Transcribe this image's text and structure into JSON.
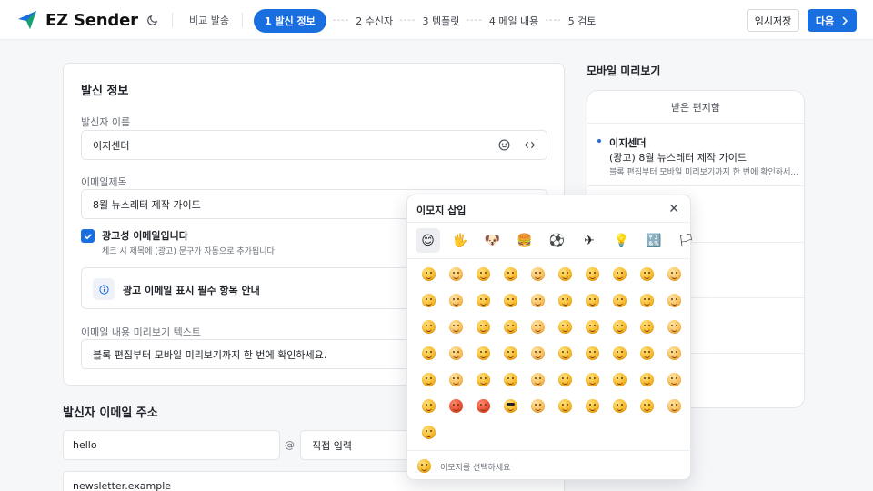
{
  "app": {
    "name": "EZ Sender",
    "accent": "#1a6fe0"
  },
  "header": {
    "nav_link": "비교 발송",
    "steps": [
      {
        "label": "1  발신 정보",
        "active": true
      },
      {
        "label": "2  수신자"
      },
      {
        "label": "3  템플릿"
      },
      {
        "label": "4  메일 내용"
      },
      {
        "label": "5  검토"
      }
    ],
    "step_separator": "----",
    "draft_button": "임시저장",
    "next_button": "다음"
  },
  "form": {
    "title": "발신 정보",
    "sender_name": {
      "label": "발신자 이름",
      "value": "이지센더"
    },
    "subject": {
      "label": "이메일제목",
      "value": "8월 뉴스레터 제작 가이드"
    },
    "ad_check": {
      "label": "광고성 이메일입니다",
      "hint": "체크 시 제목에 (광고) 문구가 자동으로 추가됩니다",
      "checked": true
    },
    "notice": "광고 이메일 표시 필수 항목 안내",
    "preheader": {
      "label": "이메일 내용 미리보기 텍스트",
      "value": "블록 편집부터 모바일 미리보기까지 한 번에 확인하세요."
    }
  },
  "sender_email": {
    "title": "발신자 이메일 주소",
    "local_part": "hello",
    "at": "@",
    "domain_select": "직접 입력",
    "domain": "newsletter.example"
  },
  "preview": {
    "title": "모바일 미리보기",
    "inbox_label": "받은 편지함",
    "mail": {
      "sender": "이지센더",
      "subject": "(광고) 8월 뉴스레터 제작 가이드",
      "snippet": "블록 편집부터 모바일 미리보기까지 한 번에 확인하세..."
    }
  },
  "emoji_picker": {
    "title": "이모지 삽입",
    "close": "✕",
    "categories": [
      "smileys-icon",
      "people-icon",
      "animals-icon",
      "food-icon",
      "activity-icon",
      "travel-icon",
      "objects-icon",
      "symbols-icon",
      "flags-icon"
    ],
    "category_glyphs": [
      "😊",
      "🖐",
      "🐶",
      "🍔",
      "⚽",
      "✈",
      "💡",
      "🔣",
      "🏳"
    ],
    "emoji_count": 61,
    "footer_hint": "이모지를 선택하세요"
  }
}
